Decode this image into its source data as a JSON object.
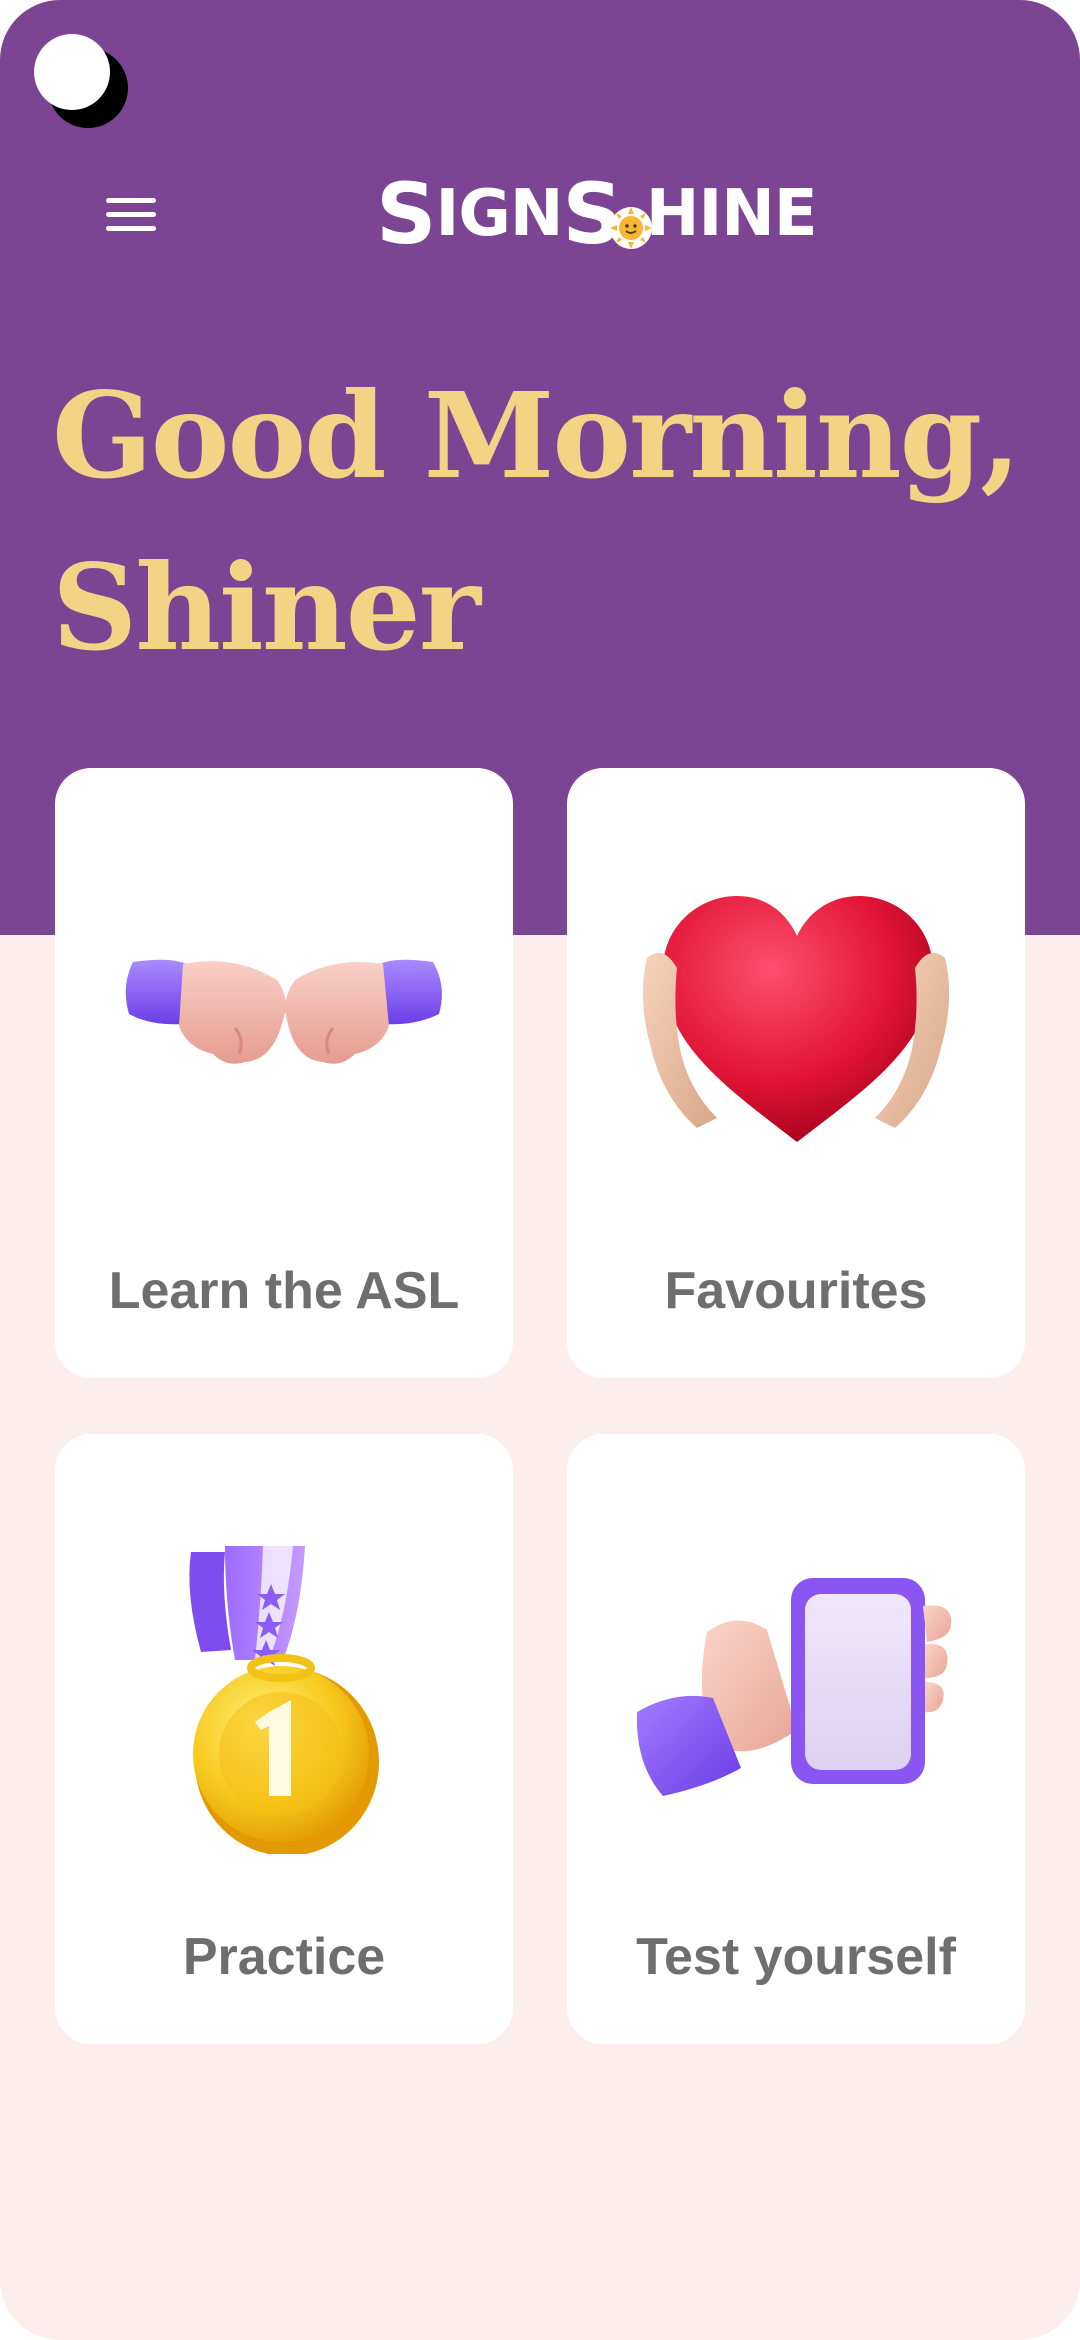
{
  "app": {
    "logo_text_1": "S",
    "logo_text_2": "IGN",
    "logo_text_3": "S",
    "logo_text_4": "HINE"
  },
  "header": {
    "greeting": "Good Morning, Shiner"
  },
  "cards": [
    {
      "label": "Learn the ASL",
      "icon": "fist-bump-icon"
    },
    {
      "label": "Favourites",
      "icon": "heart-in-hands-icon"
    },
    {
      "label": "Practice",
      "icon": "medal-icon"
    },
    {
      "label": "Test yourself",
      "icon": "hand-holding-phone-icon"
    }
  ],
  "colors": {
    "header_bg": "#7b4593",
    "page_bg": "#fdeeee",
    "greeting": "#f3d384",
    "card_bg": "#ffffff",
    "card_label": "#6e6e6e",
    "accent_purple": "#8b5cf6"
  }
}
